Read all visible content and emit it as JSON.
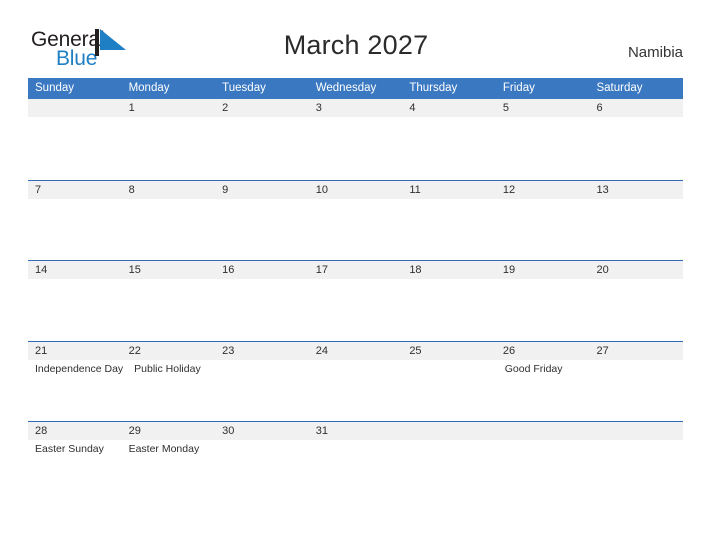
{
  "brand": {
    "name_part1": "General",
    "name_part2": "Blue",
    "flag_icon": "flag-triangle-icon",
    "accent_color": "#1f7fc4",
    "dark_color": "#231f20"
  },
  "header": {
    "title": "March 2027",
    "country": "Namibia"
  },
  "colors": {
    "weekday_header_bg": "#3a78c2",
    "row_divider": "#2f6cb3",
    "date_band_bg": "#f1f1f1",
    "page_bg": "#ffffff",
    "text": "#2f2f2f"
  },
  "weekdays": [
    "Sunday",
    "Monday",
    "Tuesday",
    "Wednesday",
    "Thursday",
    "Friday",
    "Saturday"
  ],
  "weeks": [
    {
      "days": [
        {
          "date": "",
          "event": ""
        },
        {
          "date": "1",
          "event": ""
        },
        {
          "date": "2",
          "event": ""
        },
        {
          "date": "3",
          "event": ""
        },
        {
          "date": "4",
          "event": ""
        },
        {
          "date": "5",
          "event": ""
        },
        {
          "date": "6",
          "event": ""
        }
      ]
    },
    {
      "days": [
        {
          "date": "7",
          "event": ""
        },
        {
          "date": "8",
          "event": ""
        },
        {
          "date": "9",
          "event": ""
        },
        {
          "date": "10",
          "event": ""
        },
        {
          "date": "11",
          "event": ""
        },
        {
          "date": "12",
          "event": ""
        },
        {
          "date": "13",
          "event": ""
        }
      ]
    },
    {
      "days": [
        {
          "date": "14",
          "event": ""
        },
        {
          "date": "15",
          "event": ""
        },
        {
          "date": "16",
          "event": ""
        },
        {
          "date": "17",
          "event": ""
        },
        {
          "date": "18",
          "event": ""
        },
        {
          "date": "19",
          "event": ""
        },
        {
          "date": "20",
          "event": ""
        }
      ]
    },
    {
      "days": [
        {
          "date": "21",
          "event": "Independence Day"
        },
        {
          "date": "22",
          "event": "Public Holiday"
        },
        {
          "date": "23",
          "event": ""
        },
        {
          "date": "24",
          "event": ""
        },
        {
          "date": "25",
          "event": ""
        },
        {
          "date": "26",
          "event": "Good Friday"
        },
        {
          "date": "27",
          "event": ""
        }
      ]
    },
    {
      "days": [
        {
          "date": "28",
          "event": "Easter Sunday"
        },
        {
          "date": "29",
          "event": "Easter Monday"
        },
        {
          "date": "30",
          "event": ""
        },
        {
          "date": "31",
          "event": ""
        },
        {
          "date": "",
          "event": ""
        },
        {
          "date": "",
          "event": ""
        },
        {
          "date": "",
          "event": ""
        }
      ]
    }
  ]
}
